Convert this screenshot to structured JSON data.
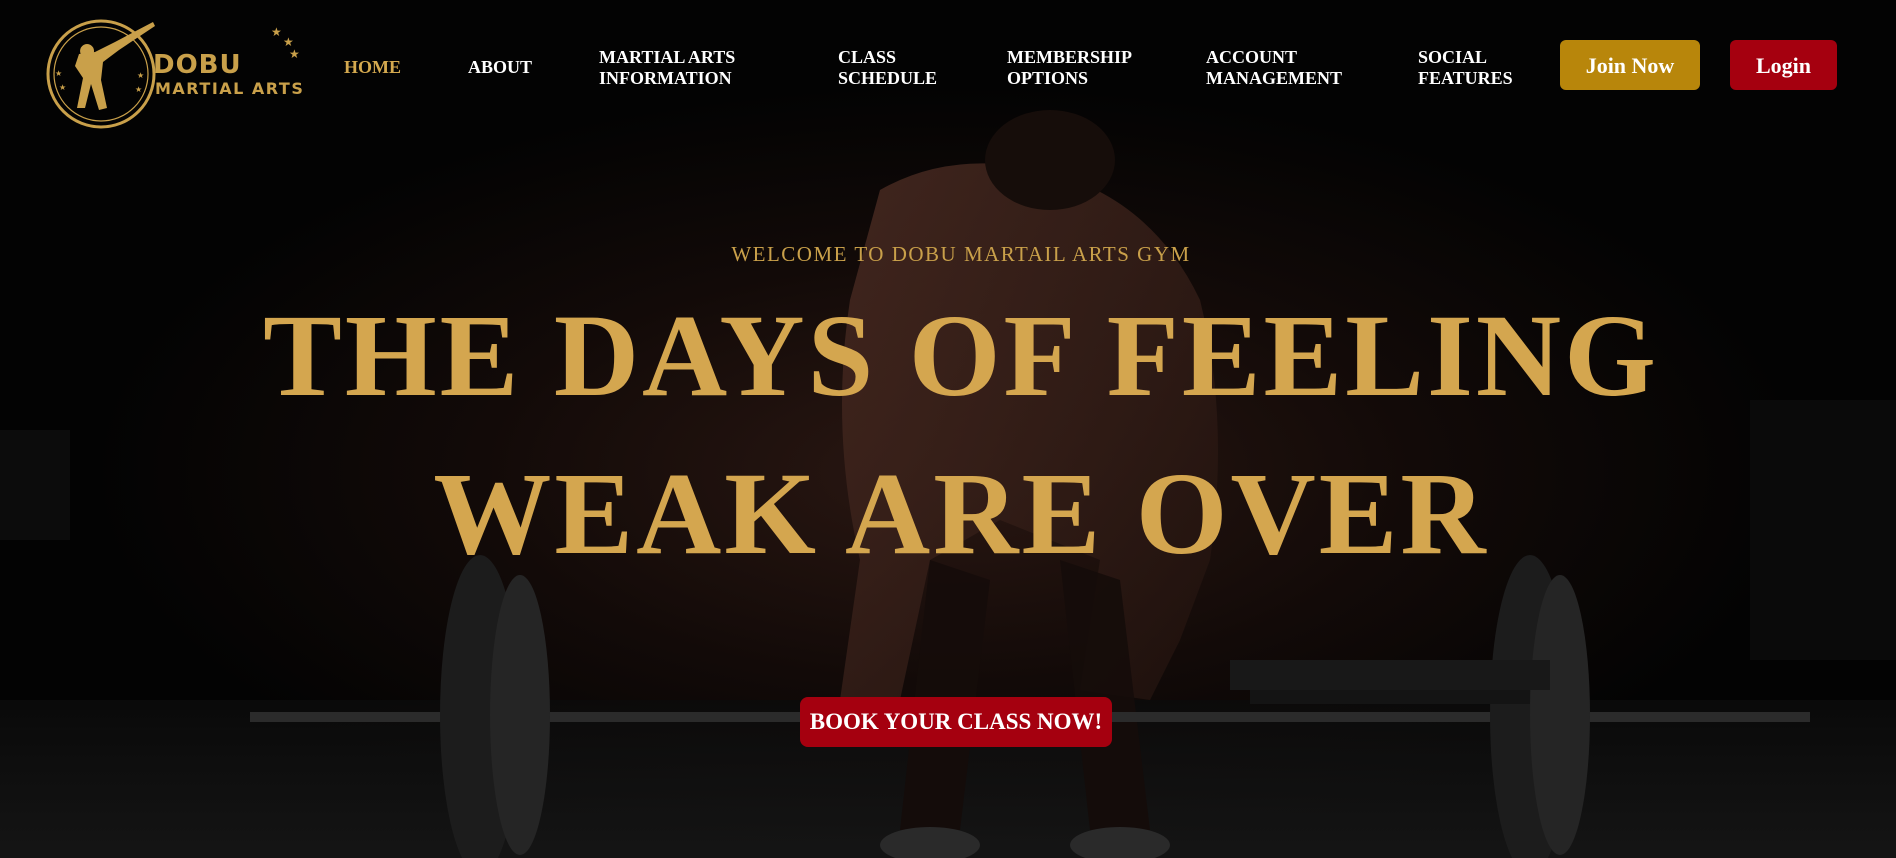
{
  "brand": {
    "name": "DOBU",
    "tagline": "MARTIAL ARTS"
  },
  "nav": {
    "items": [
      {
        "line1": "HOME",
        "line2": ""
      },
      {
        "line1": "ABOUT",
        "line2": ""
      },
      {
        "line1": "MARTIAL ARTS",
        "line2": "INFORMATION"
      },
      {
        "line1": "CLASS",
        "line2": "SCHEDULE"
      },
      {
        "line1": "MEMBERSHIP",
        "line2": "OPTIONS"
      },
      {
        "line1": "ACCOUNT",
        "line2": "MANAGEMENT"
      },
      {
        "line1": "SOCIAL",
        "line2": "FEATURES"
      }
    ],
    "active": "HOME"
  },
  "actions": {
    "join_label": "Join Now",
    "login_label": "Login"
  },
  "hero": {
    "welcome": "WELCOME TO DOBU MARTAIL ARTS GYM",
    "headline_line1": "THE DAYS OF FEELING",
    "headline_line2": "WEAK ARE OVER",
    "cta_label": "BOOK YOUR CLASS NOW!"
  },
  "colors": {
    "gold": "#d4a64f",
    "join_button": "#b8860b",
    "red": "#a5000f",
    "background": "#030303"
  }
}
